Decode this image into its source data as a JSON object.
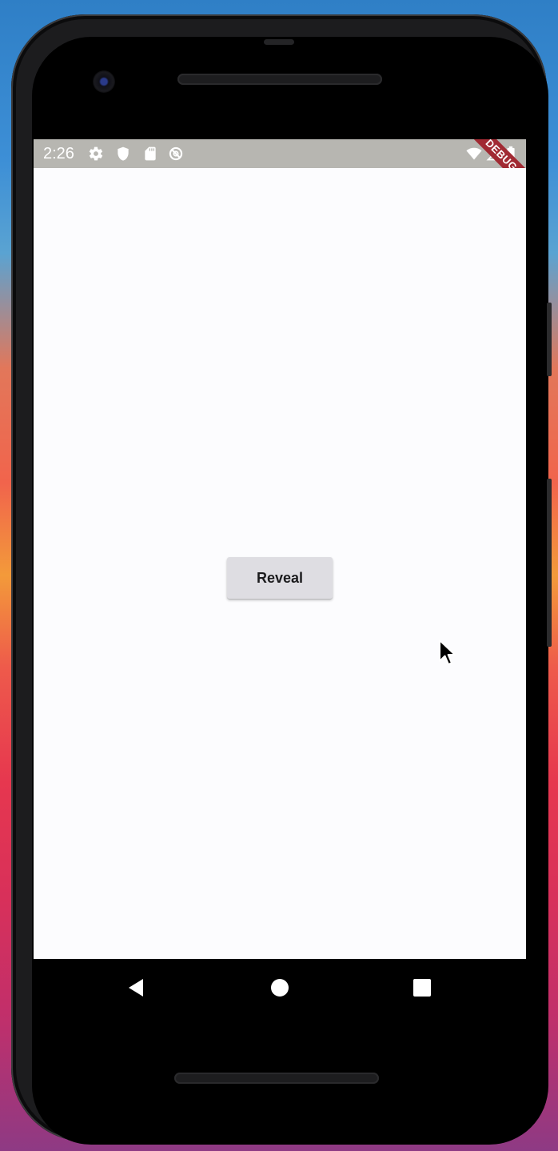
{
  "status_bar": {
    "time": "2:26",
    "left_icons": [
      "gear-icon",
      "shield-icon",
      "sd-card-icon",
      "no-sync-icon"
    ],
    "right_icons": [
      "wifi-icon",
      "signal-icon",
      "battery-icon"
    ]
  },
  "debug_banner": {
    "label": "DEBUG",
    "color": "#a12a33"
  },
  "main": {
    "reveal_button_label": "Reveal"
  },
  "nav_bar": {
    "buttons": [
      "back-icon",
      "home-icon",
      "recents-icon"
    ]
  },
  "colors": {
    "status_bar": "#b7b6b1",
    "screen_background": "#fcfcfe",
    "button_background": "#dedde2"
  }
}
